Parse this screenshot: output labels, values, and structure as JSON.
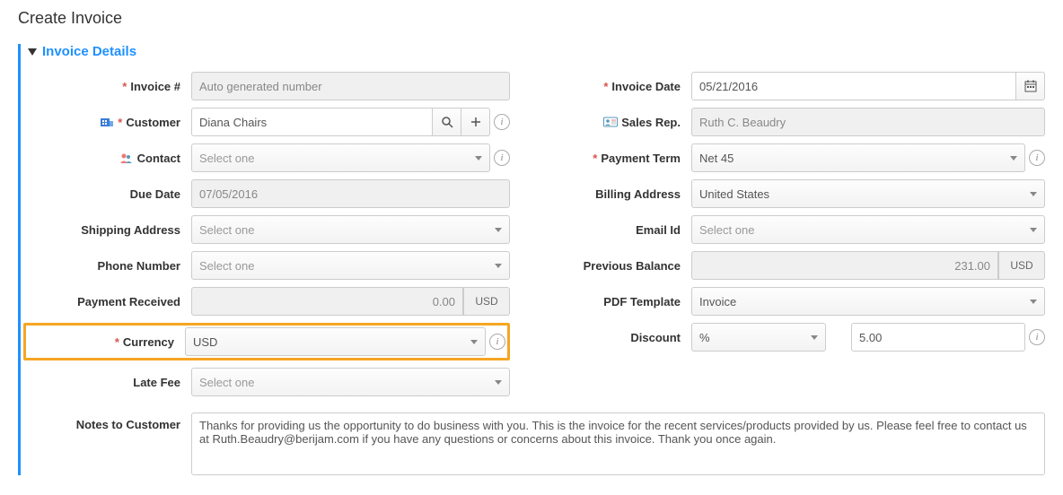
{
  "page": {
    "title": "Create Invoice"
  },
  "section": {
    "title": "Invoice Details"
  },
  "labels": {
    "invoice_no": "Invoice #",
    "customer": "Customer",
    "contact": "Contact",
    "due_date": "Due Date",
    "shipping_address": "Shipping Address",
    "phone_number": "Phone Number",
    "payment_received": "Payment Received",
    "currency": "Currency",
    "late_fee": "Late Fee",
    "invoice_date": "Invoice Date",
    "sales_rep": "Sales Rep.",
    "payment_term": "Payment Term",
    "billing_address": "Billing Address",
    "email_id": "Email Id",
    "previous_balance": "Previous Balance",
    "pdf_template": "PDF Template",
    "discount": "Discount",
    "notes": "Notes to Customer"
  },
  "placeholders": {
    "select_one": "Select one"
  },
  "values": {
    "invoice_no": "Auto generated number",
    "customer": "Diana Chairs",
    "due_date": "07/05/2016",
    "payment_received": "0.00",
    "currency": "USD",
    "invoice_date": "05/21/2016",
    "sales_rep": "Ruth C. Beaudry",
    "payment_term": "Net 45",
    "billing_address": "United States",
    "previous_balance": "231.00",
    "pdf_template": "Invoice",
    "discount_type": "%",
    "discount_value": "5.00",
    "notes": "Thanks for providing us the opportunity to do business with you. This is the invoice for the recent services/products provided by us. Please feel free to contact us at Ruth.Beaudry@berijam.com if you have any questions or concerns about this invoice. Thank you once again."
  },
  "units": {
    "usd": "USD"
  }
}
